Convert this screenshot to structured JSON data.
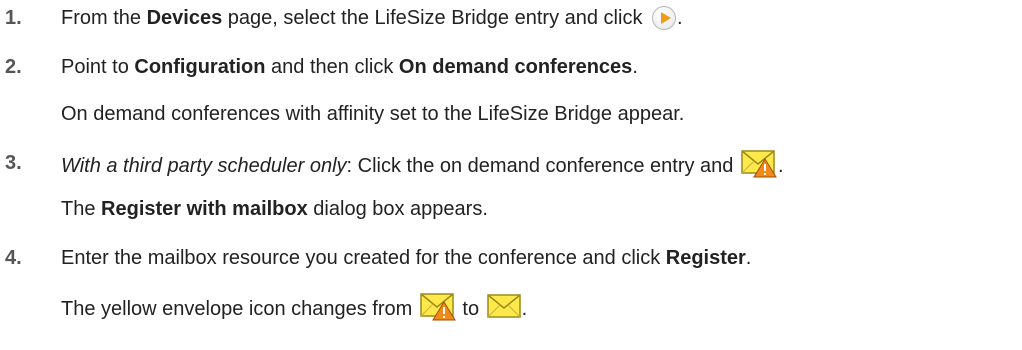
{
  "steps": [
    {
      "number": "1.",
      "t1": "From the ",
      "b1": "Devices",
      "t2": " page, select the LifeSize Bridge entry and click ",
      "t3": ".",
      "icon": "play-button-icon"
    },
    {
      "number": "2.",
      "t1": "Point to ",
      "b1": "Configuration",
      "t2": " and then click ",
      "b2": "On demand conferences",
      "t3": ".",
      "result": "On demand conferences with affinity set to the LifeSize Bridge appear."
    },
    {
      "number": "3.",
      "i1": "With a third party scheduler only",
      "t1": ": Click the on demand conference entry and ",
      "t2": ".",
      "icon": "envelope-warning-icon",
      "result_t1": "The ",
      "result_b1": "Register with mailbox",
      "result_t2": " dialog box appears."
    },
    {
      "number": "4.",
      "t1": "Enter the mailbox resource you created for the conference and click ",
      "b1": "Register",
      "t2": ".",
      "result_t1": "The yellow envelope icon changes from ",
      "result_t2": " to ",
      "result_t3": ".",
      "icon_from": "envelope-warning-icon",
      "icon_to": "envelope-icon"
    }
  ],
  "colors": {
    "text": "#222222",
    "step_number": "#555555",
    "envelope_fill": "#ffe94a",
    "envelope_stroke": "#9c8a1a",
    "warning": "#f08a1a",
    "play_arrow": "#f39a16"
  }
}
